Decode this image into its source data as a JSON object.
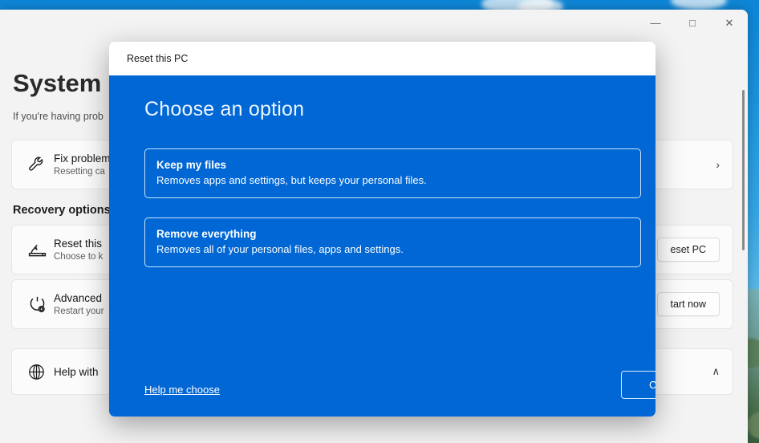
{
  "window": {
    "controls": [
      {
        "name": "minimize",
        "glyph": "—"
      },
      {
        "name": "maximize",
        "glyph": "□"
      },
      {
        "name": "close",
        "glyph": "✕"
      }
    ]
  },
  "settings": {
    "page_title": "System",
    "breadcrumb_chevron": "›",
    "subtitle": "If you're having prob",
    "cards": [
      {
        "title": "Fix problem",
        "subtitle": "Resetting ca",
        "icon": "wrench-icon",
        "action_glyph": "›",
        "action_type": "chevron"
      }
    ],
    "section_heading": "Recovery options",
    "recovery_cards": [
      {
        "title": "Reset this",
        "subtitle": "Choose to k",
        "icon": "reset-pc-icon",
        "button_label": "eset PC",
        "action_type": "button"
      },
      {
        "title": "Advanced",
        "subtitle": "Restart your",
        "icon": "advanced-startup-icon",
        "button_label": "tart now",
        "action_type": "button"
      }
    ],
    "help_card": {
      "title": "Help with",
      "icon": "globe-icon",
      "action_glyph": "∧",
      "action_type": "chevron-up"
    }
  },
  "dialog": {
    "title": "Reset this PC",
    "heading": "Choose an option",
    "options": [
      {
        "title": "Keep my files",
        "description": "Removes apps and settings, but keeps your personal files."
      },
      {
        "title": "Remove everything",
        "description": "Removes all of your personal files, apps and settings."
      }
    ],
    "help_link": "Help me choose",
    "cancel_label": "Cancel"
  },
  "colors": {
    "dialog_blue": "#0067d5",
    "window_chrome": "#f3f3f3",
    "card_bg": "#fbfbfb"
  }
}
